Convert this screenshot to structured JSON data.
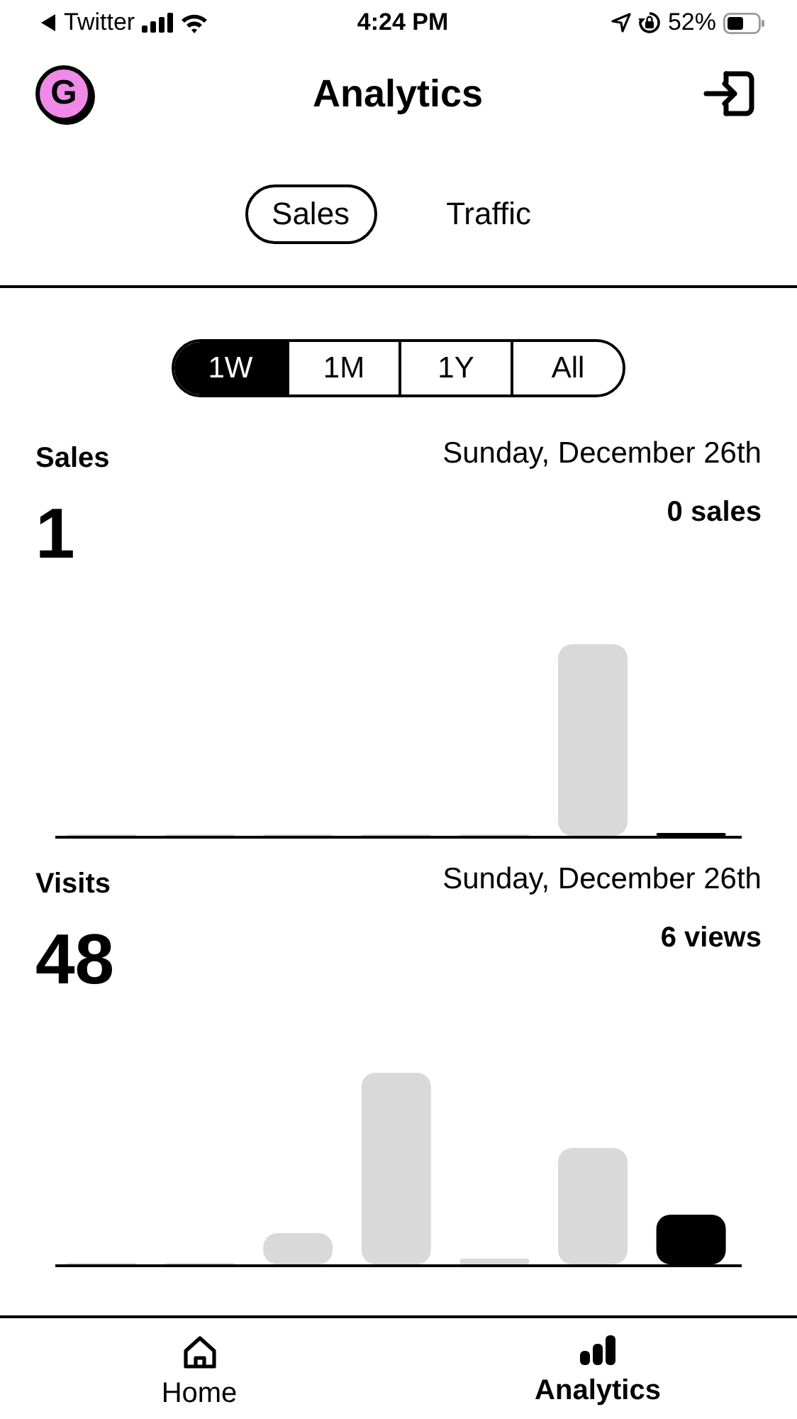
{
  "status_bar": {
    "back_app": "Twitter",
    "time": "4:24 PM",
    "battery": "52%"
  },
  "header": {
    "avatar": "G",
    "title": "Analytics"
  },
  "tabs": [
    {
      "label": "Sales",
      "selected": true
    },
    {
      "label": "Traffic",
      "selected": false
    }
  ],
  "ranges": [
    {
      "label": "1W",
      "selected": true
    },
    {
      "label": "1M",
      "selected": false
    },
    {
      "label": "1Y",
      "selected": false
    },
    {
      "label": "All",
      "selected": false
    }
  ],
  "metrics": [
    {
      "label": "Sales",
      "total": "1",
      "date": "Sunday, December 26th",
      "detail": "0 sales",
      "bars": [
        {
          "selected": false
        },
        {
          "selected": false
        },
        {
          "selected": false
        },
        {
          "selected": false
        },
        {
          "selected": false
        },
        {
          "selected": false
        },
        {
          "selected": true
        }
      ]
    },
    {
      "label": "Visits",
      "total": "48",
      "date": "Sunday, December 26th",
      "detail": "6 views",
      "bars": [
        {
          "selected": false
        },
        {
          "selected": false
        },
        {
          "selected": false
        },
        {
          "selected": false
        },
        {
          "selected": false
        },
        {
          "selected": false
        },
        {
          "selected": true
        }
      ]
    }
  ],
  "tab_bar": [
    {
      "label": "Home",
      "kind": "home",
      "selected": false
    },
    {
      "label": "Analytics",
      "kind": "analytics",
      "selected": true
    }
  ]
}
